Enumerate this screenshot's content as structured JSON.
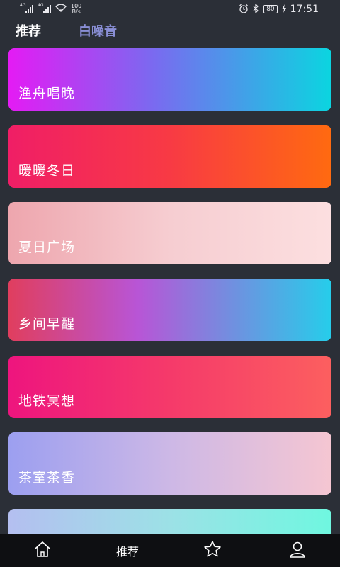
{
  "status_bar": {
    "sim1_label": "4G",
    "sim2_label": "4G",
    "net_speed_value": "100",
    "net_speed_unit": "B/s",
    "battery": "80",
    "time": "17:51"
  },
  "tabs": {
    "recommend": "推荐",
    "white_noise": "白噪音"
  },
  "cards": [
    {
      "label": "渔舟唱晚"
    },
    {
      "label": "暖暖冬日"
    },
    {
      "label": "夏日广场"
    },
    {
      "label": "乡间早醒"
    },
    {
      "label": "地铁冥想"
    },
    {
      "label": "茶室茶香"
    }
  ],
  "bottom_nav": {
    "recommend_label": "推荐",
    "icons": [
      "home-icon",
      "star-icon",
      "user-icon"
    ]
  },
  "colors": {
    "background": "#2b2f37",
    "tab_inactive": "#8a8fd6",
    "nav_background": "#0e0f12"
  }
}
